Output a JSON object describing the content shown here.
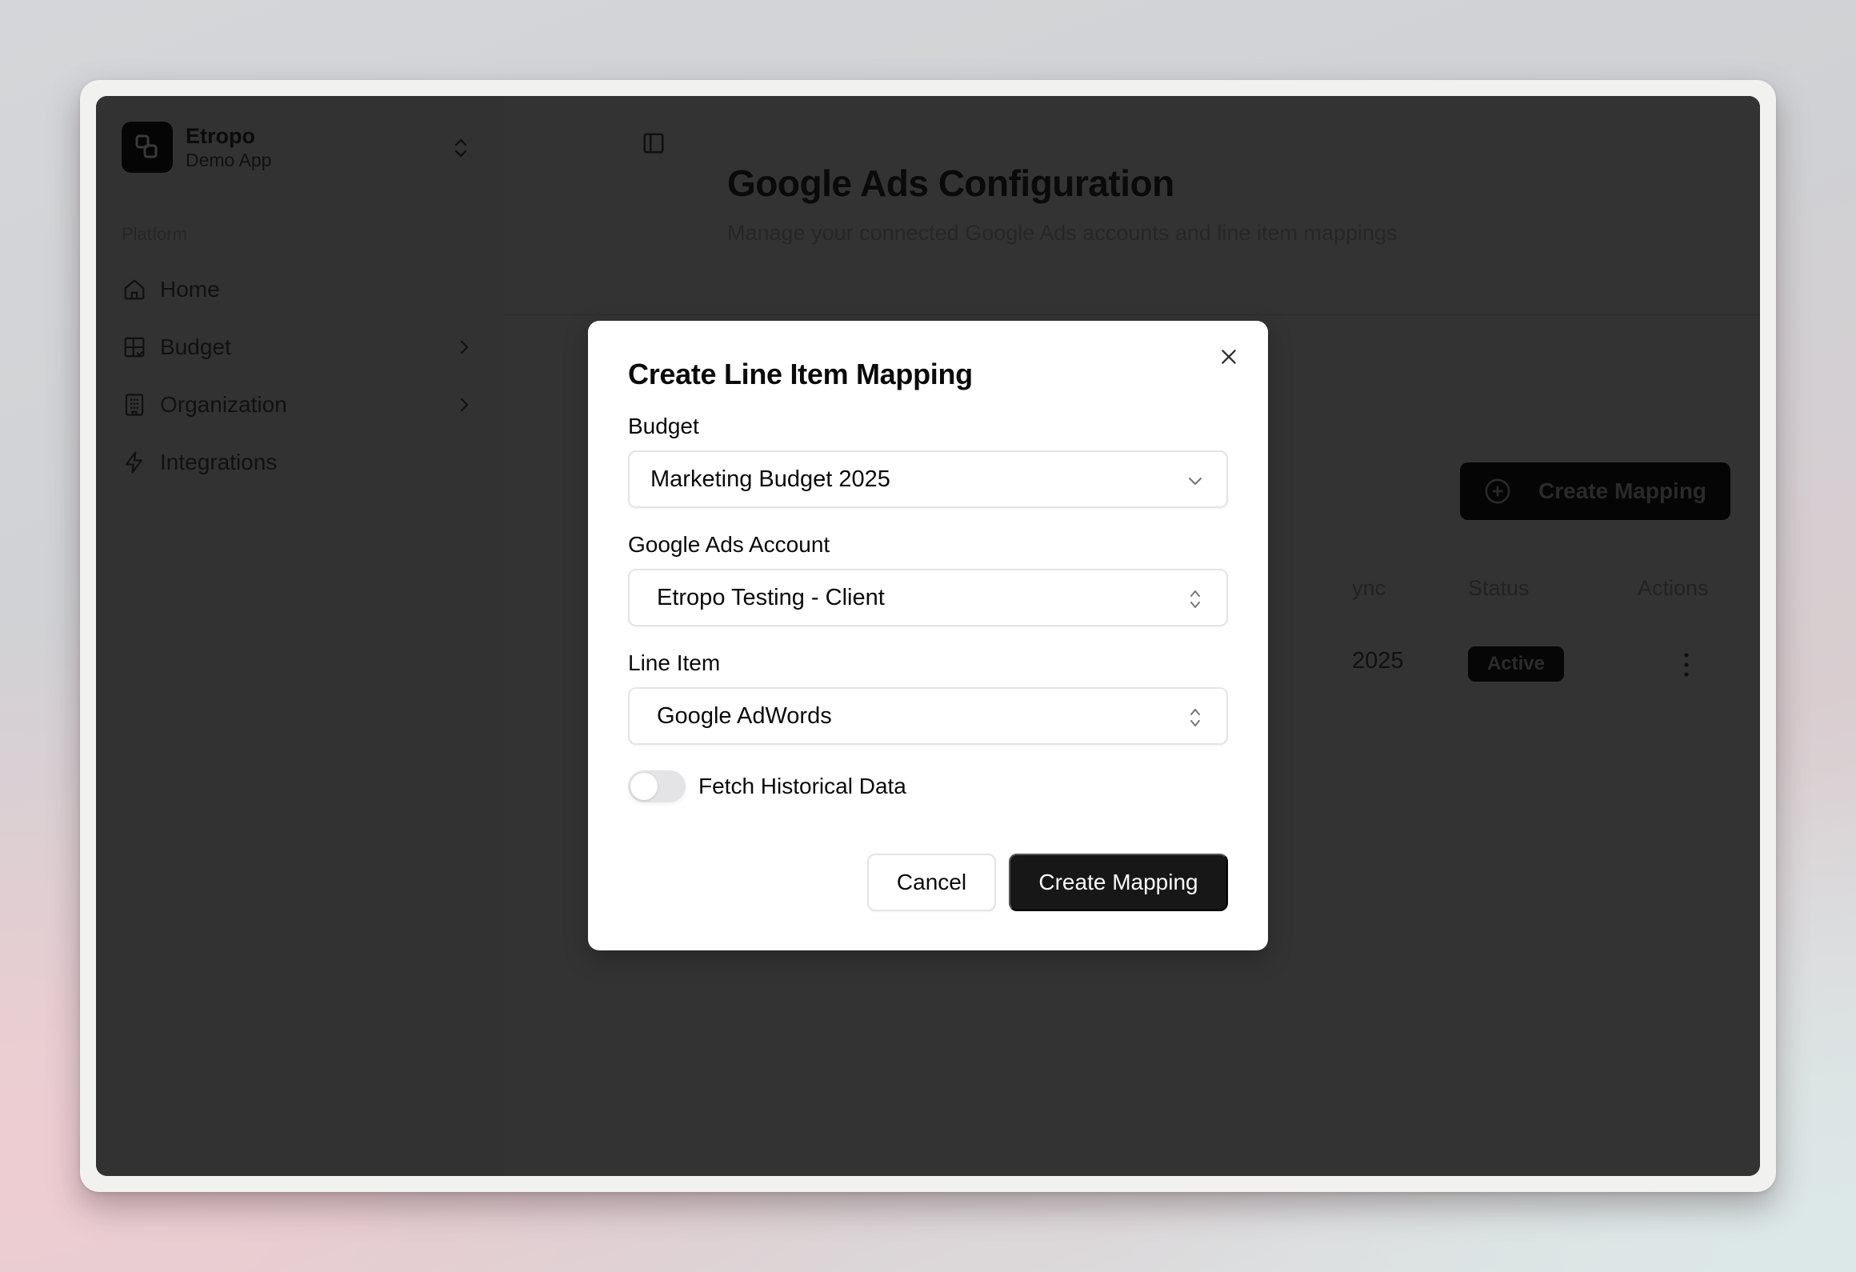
{
  "app": {
    "brand_name": "Etropo",
    "brand_sub": "Demo App"
  },
  "sidebar": {
    "section_label": "Platform",
    "items": [
      {
        "label": "Home",
        "icon": "home-icon",
        "has_chevron": false
      },
      {
        "label": "Budget",
        "icon": "budget-grid-icon",
        "has_chevron": true
      },
      {
        "label": "Organization",
        "icon": "building-icon",
        "has_chevron": true
      },
      {
        "label": "Integrations",
        "icon": "lightning-icon",
        "has_chevron": false
      }
    ]
  },
  "page": {
    "title": "Google Ads Configuration",
    "subtitle": "Manage your connected Google Ads accounts and line item mappings",
    "create_button_label": "Create Mapping",
    "table": {
      "headers_visible": [
        "ync",
        "Status",
        "Actions"
      ],
      "rows": [
        {
          "last_sync_partial": "2025",
          "status": "Active"
        }
      ]
    }
  },
  "modal": {
    "title": "Create Line Item Mapping",
    "fields": {
      "budget": {
        "label": "Budget",
        "value": "Marketing Budget 2025"
      },
      "ads_account": {
        "label": "Google Ads Account",
        "value": "Etropo Testing - Client"
      },
      "line_item": {
        "label": "Line Item",
        "value": "Google AdWords"
      }
    },
    "toggle": {
      "label": "Fetch Historical Data",
      "checked": false
    },
    "cancel_label": "Cancel",
    "submit_label": "Create Mapping"
  },
  "colors": {
    "app_bg": "#333333",
    "modal_bg": "#ffffff",
    "primary_button": "#171717",
    "border": "#e4e4e7"
  }
}
